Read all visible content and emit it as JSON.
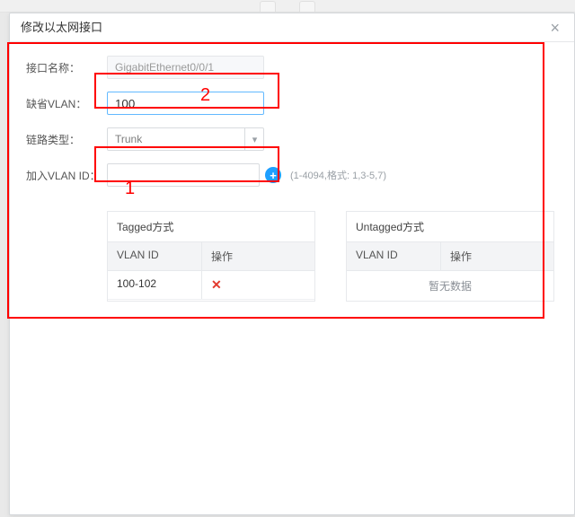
{
  "tabs_bg": {
    "left": "",
    "right": ""
  },
  "modal": {
    "title": "修改以太网接口",
    "close_glyph": "×"
  },
  "form": {
    "iface_label": "接口名称：",
    "iface_value": "GigabitEthernet0/0/1",
    "default_vlan_label": "缺省VLAN：",
    "default_vlan_value": "100",
    "link_type_label": "链路类型：",
    "link_type_value": "Trunk",
    "add_vlan_label": "加入VLAN ID：",
    "add_vlan_value": "",
    "add_vlan_hint": "(1-4094,格式: 1,3-5,7)",
    "plus_glyph": "+"
  },
  "tagged": {
    "title": "Tagged方式",
    "col_id": "VLAN ID",
    "col_op": "操作",
    "rows": [
      {
        "id": "100-102",
        "op_glyph": "✕"
      }
    ]
  },
  "untagged": {
    "title": "Untagged方式",
    "col_id": "VLAN ID",
    "col_op": "操作",
    "empty_text": "暂无数据"
  },
  "annotations": {
    "a1": "1",
    "a2": "2"
  }
}
